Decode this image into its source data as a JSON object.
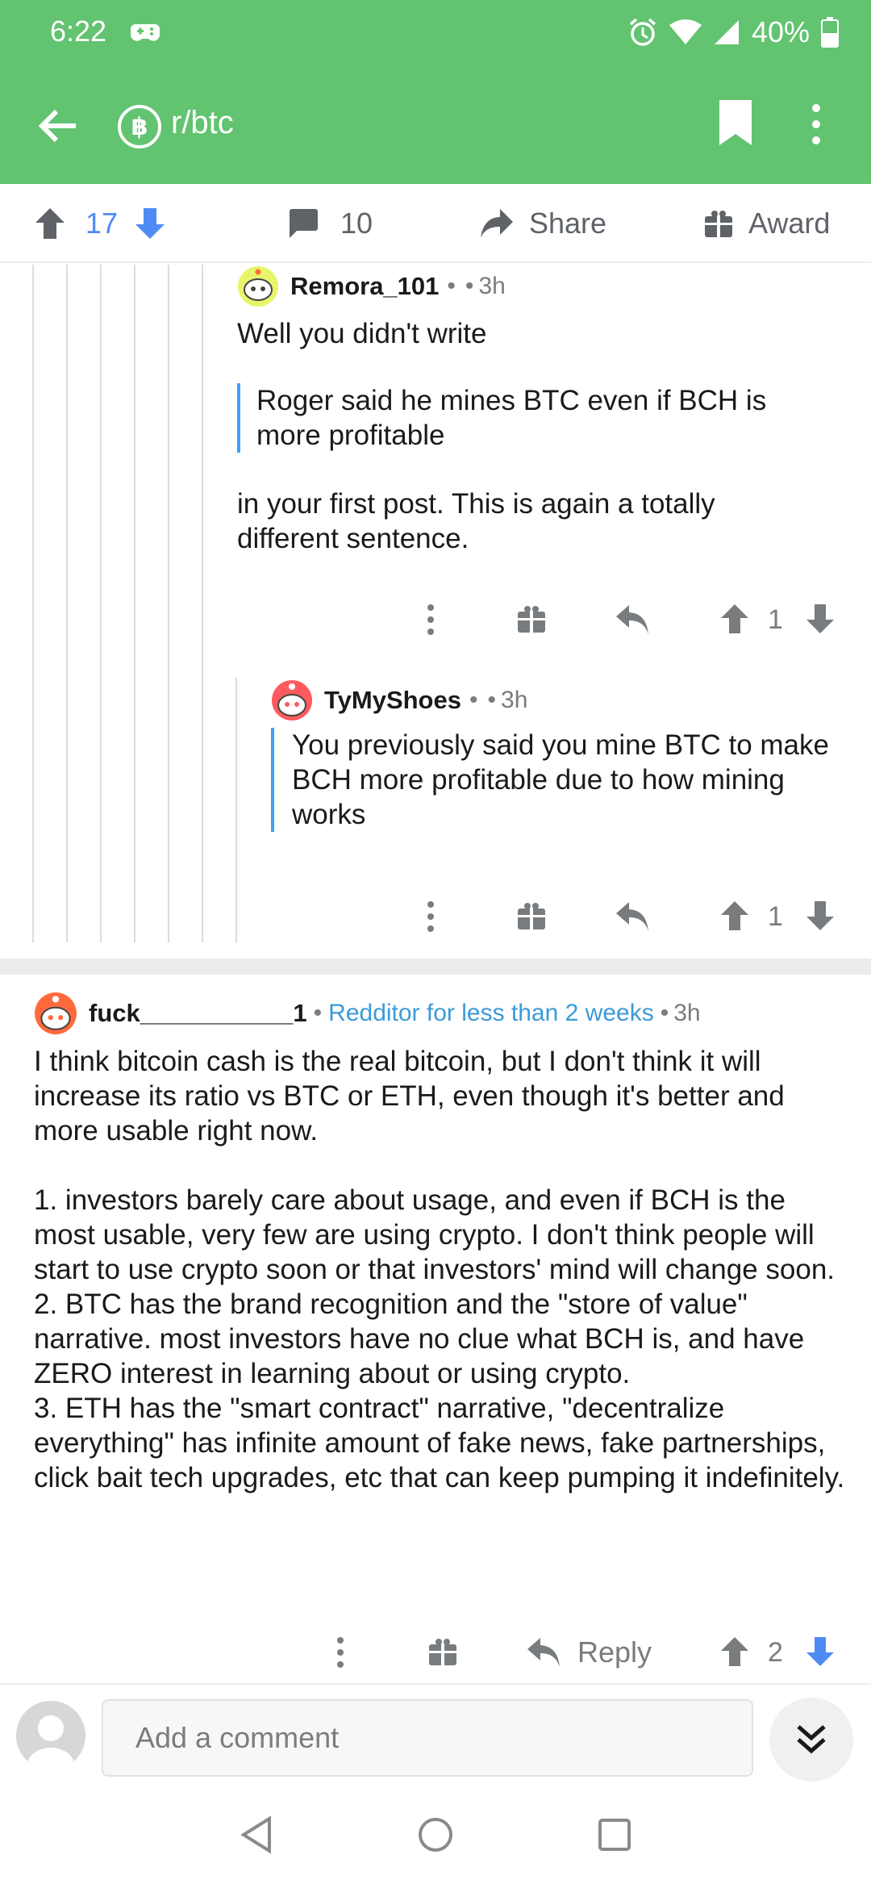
{
  "status_bar": {
    "time": "6:22",
    "battery": "40%"
  },
  "app_bar": {
    "subreddit": "r/btc",
    "sub_icon_glyph": "฿"
  },
  "post_actions": {
    "score": "17",
    "comments": "10",
    "share": "Share",
    "award": "Award"
  },
  "comments": [
    {
      "username": "Remora_101",
      "separator": "•",
      "dot": "•",
      "age": "3h",
      "text_before": "Well you didn't write",
      "quote": "Roger said he mines BTC even if BCH is more profitable",
      "text_after": "in your first post. This is again a totally different sentence.",
      "score": "1"
    },
    {
      "username": "TyMyShoes",
      "separator": "•",
      "dot": "•",
      "age": "3h",
      "quote": "You previously said you mine BTC to make BCH more profitable due to how mining works",
      "score": "1"
    },
    {
      "username": "fuck___________1",
      "separator": "•",
      "flair": "Redditor for less than 2 weeks",
      "dot": "•",
      "age": "3h",
      "para1": "I think bitcoin cash is the real bitcoin, but I don't think it will increase its ratio vs BTC or ETH, even though it's better and more usable right now.",
      "para2": "1. investors barely care about usage, and even if BCH is the most usable, very few are using crypto. I don't think people will start to use crypto soon or that investors' mind will change soon.",
      "para3": "2. BTC has the brand recognition and the \"store of value\" narrative. most investors have no clue what BCH is, and have ZERO interest in learning about or using crypto.",
      "para4": "3. ETH has the \"smart contract\" narrative, \"decentralize everything\" has infinite amount of fake news, fake partnerships, click bait tech upgrades, etc that can keep pumping it indefinitely.",
      "reply": "Reply",
      "score": "2"
    }
  ],
  "composer": {
    "placeholder": "Add a comment"
  },
  "colors": {
    "brand": "#62c370",
    "vote_blue": "#4f8bf5",
    "quote_bar": "#3aa0ff",
    "flair": "#3a9ad9"
  }
}
